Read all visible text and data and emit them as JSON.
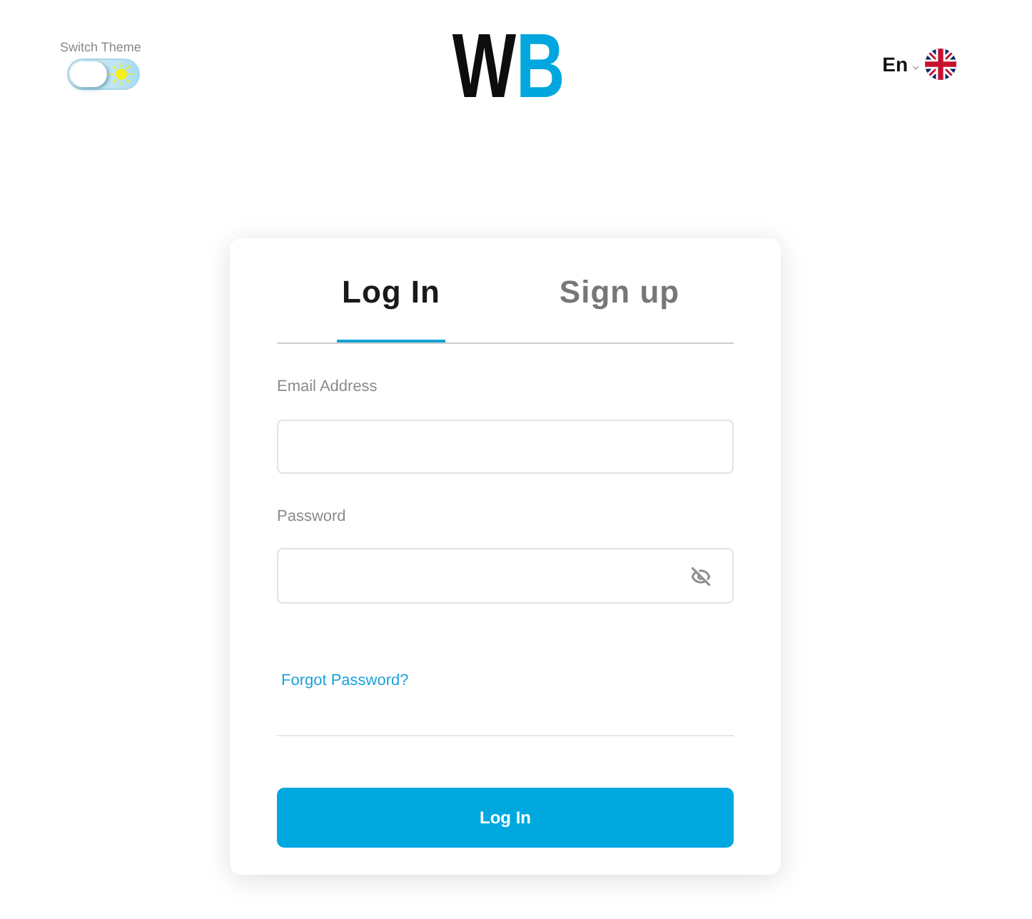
{
  "header": {
    "theme_switch": {
      "label": "Switch Theme",
      "on": false
    },
    "logo": [
      {
        "text": "W",
        "color": "#0d0d0d"
      },
      {
        "text": "B",
        "color": "#00a6de"
      }
    ],
    "language": {
      "label": "En"
    }
  },
  "login_card": {
    "tabs": [
      {
        "label": "Log In",
        "selected": true
      },
      {
        "label": "Sign up",
        "selected": false
      }
    ],
    "fields": [
      {
        "kind": "email",
        "label": "Email Address"
      },
      {
        "kind": "password",
        "label": "Password",
        "revealed": false
      }
    ],
    "forgot_link": "Forgot Password?",
    "submit_button": "Log In"
  }
}
